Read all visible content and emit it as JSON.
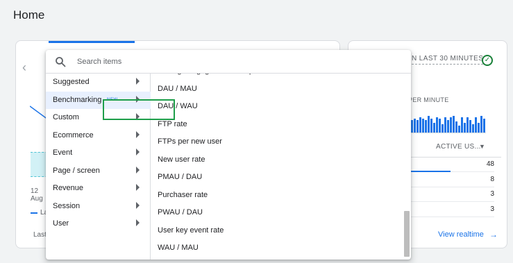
{
  "page": {
    "title": "Home"
  },
  "left_card": {
    "axis_day": "12",
    "axis_month": "Aug",
    "legend_label": "La",
    "footer_label": "Last"
  },
  "realtime_card": {
    "title": "N LAST 30 MINUTES",
    "per_minute_label": "PER MINUTE",
    "column_header": "ACTIVE US...",
    "rows": [
      {
        "value": "48",
        "share": 1.0
      },
      {
        "value": "8",
        "share": 0.17
      },
      {
        "value": "3",
        "share": 0.06
      },
      {
        "value": "3",
        "share": 0.06
      }
    ],
    "view_link": "View realtime",
    "status_color": "#188038"
  },
  "dropdown": {
    "search_placeholder": "Search items",
    "categories": [
      {
        "label": "Suggested",
        "badge": "",
        "active": false
      },
      {
        "label": "Benchmarking",
        "badge": "NEW",
        "active": true
      },
      {
        "label": "Custom",
        "badge": "",
        "active": false
      },
      {
        "label": "Ecommerce",
        "badge": "",
        "active": false
      },
      {
        "label": "Event",
        "badge": "",
        "active": false
      },
      {
        "label": "Page / screen",
        "badge": "",
        "active": false
      },
      {
        "label": "Revenue",
        "badge": "",
        "active": false
      },
      {
        "label": "Session",
        "badge": "",
        "active": false
      },
      {
        "label": "User",
        "badge": "",
        "active": false
      }
    ],
    "metrics": [
      "Average engagement time per session",
      "DAU / MAU",
      "DAU / WAU",
      "FTP rate",
      "FTPs per new user",
      "New user rate",
      "PMAU / DAU",
      "Purchaser rate",
      "PWAU / DAU",
      "User key event rate",
      "WAU / MAU"
    ],
    "highlighted_metric": "New user rate",
    "highlight_color": "#1e9e4a",
    "accent_color": "#1a73e8"
  }
}
